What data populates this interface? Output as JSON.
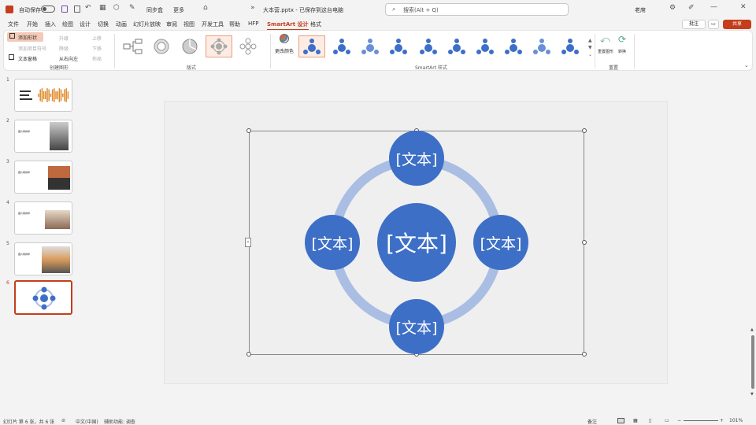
{
  "titlebar": {
    "autosave_label": "自动保存",
    "file_title": "大本营.pptx - 已保存到这台电脑",
    "search_placeholder": "搜索(Alt + Q)",
    "user_name": "老席",
    "rewrite_label": "同步盒",
    "more_label": "更多"
  },
  "tabs": [
    {
      "label": "文件"
    },
    {
      "label": "开始"
    },
    {
      "label": "插入"
    },
    {
      "label": "绘图"
    },
    {
      "label": "设计"
    },
    {
      "label": "切换"
    },
    {
      "label": "动画"
    },
    {
      "label": "幻灯片放映"
    },
    {
      "label": "审阅"
    },
    {
      "label": "视图"
    },
    {
      "label": "开发工具"
    },
    {
      "label": "帮助"
    },
    {
      "label": "HFP"
    },
    {
      "label": "SmartArt 设计",
      "active": true
    },
    {
      "label": "格式"
    }
  ],
  "right_buttons": {
    "comment": "批注",
    "share": "共享",
    "present": "▭"
  },
  "ribbon": {
    "create_group": {
      "label": "创建图形",
      "add_shape": "添加形状",
      "add_bullet": "添加项目符号",
      "text_pane": "文本窗格",
      "promote": "升级",
      "demote": "降级",
      "right_to_left": "从右向左",
      "move_up": "上移",
      "move_down": "下移",
      "layout": "布局"
    },
    "layout_group": {
      "label": "版式"
    },
    "styles_group": {
      "label": "SmartArt 样式",
      "change_colors": "更改颜色"
    },
    "reset_group": {
      "label": "重置",
      "reset_graphic": "重置图形",
      "convert": "转换"
    }
  },
  "slides": [
    {
      "num": "1"
    },
    {
      "num": "2",
      "title": "图片网排样"
    },
    {
      "num": "3",
      "title": "图片网排样"
    },
    {
      "num": "4",
      "title": "图片网排样"
    },
    {
      "num": "5",
      "title": "图片网排样"
    },
    {
      "num": "6",
      "active": true
    }
  ],
  "smartart": {
    "center_text": "[文本]",
    "top_text": "[文本]",
    "left_text": "[文本]",
    "right_text": "[文本]",
    "bottom_text": "[文本]",
    "node_color": "#3d6fc7",
    "ring_color": "#aabde3"
  },
  "status": {
    "slide_info": "幻灯片 第 6 张，共 6 张",
    "language": "中文(中国)",
    "accessibility": "辅助功能: 调查",
    "notes": "备注",
    "zoom": "101%"
  }
}
